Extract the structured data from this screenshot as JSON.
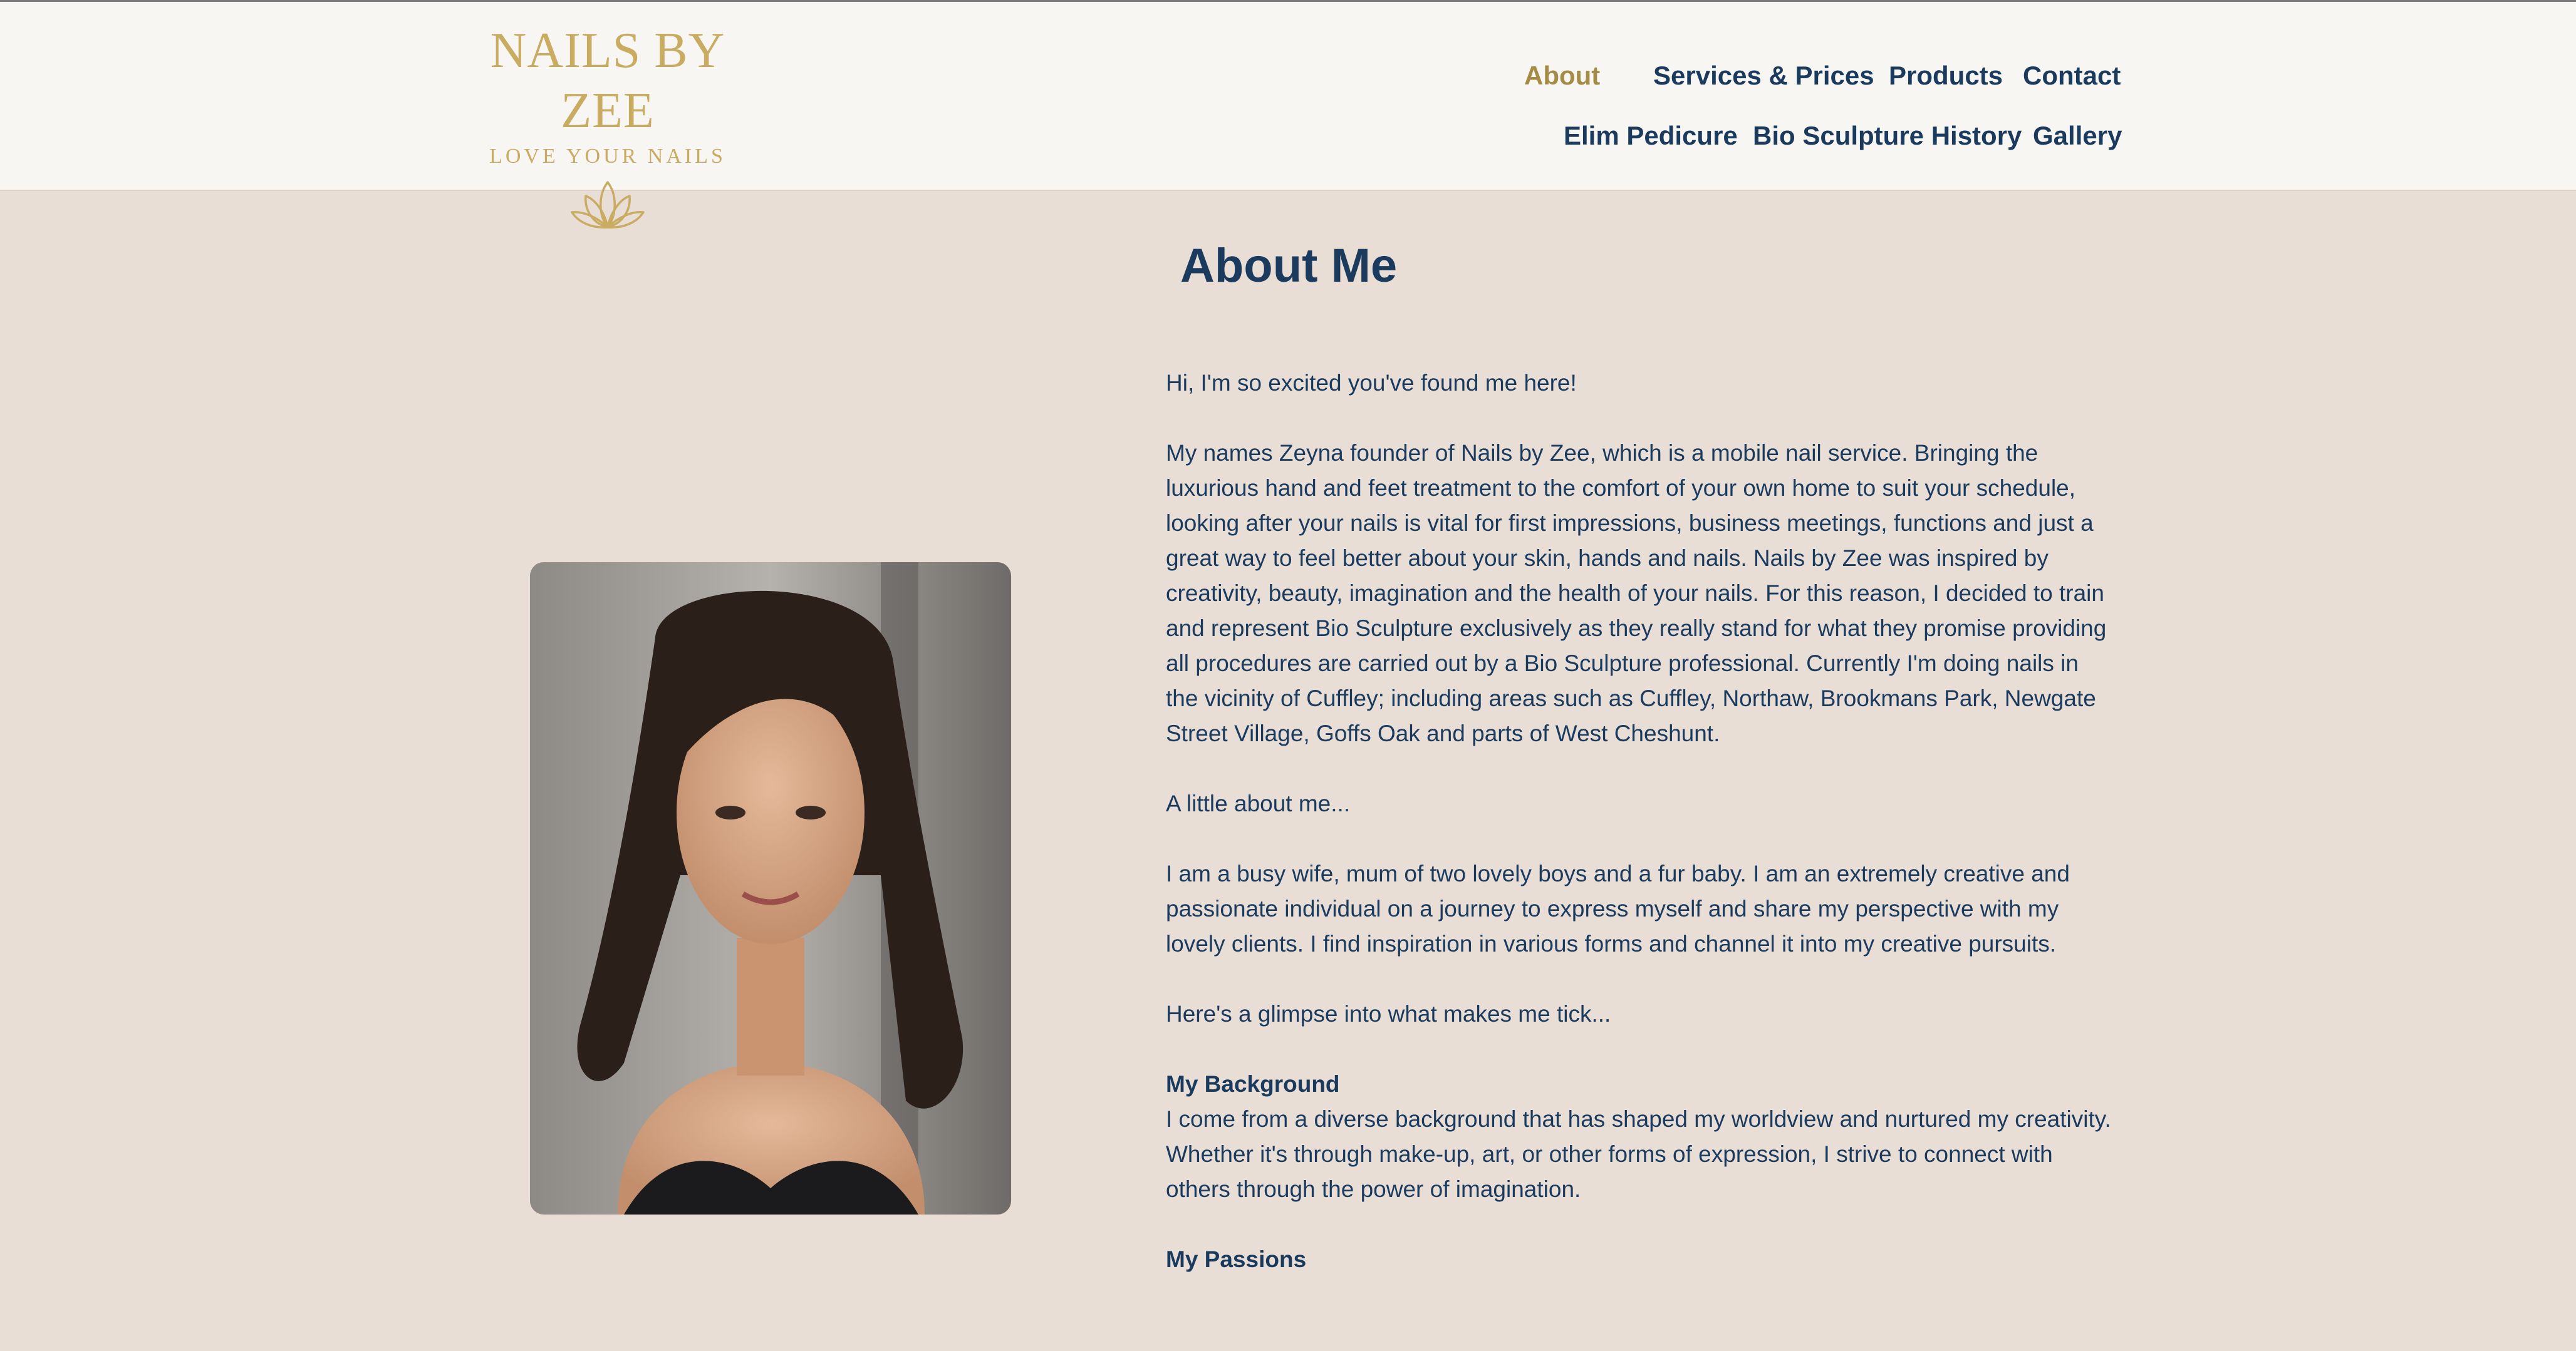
{
  "brand": {
    "name": "NAILS BY ZEE",
    "tagline": "LOVE YOUR NAILS",
    "logo_icon": "lotus-icon",
    "color": "#c9ab62"
  },
  "nav": {
    "items": [
      {
        "label": "About",
        "active": true
      },
      {
        "label": "Services & Prices"
      },
      {
        "label": "Products"
      },
      {
        "label": "Contact"
      },
      {
        "label": "Elim Pedicure"
      },
      {
        "label": "Bio Sculpture History"
      },
      {
        "label": "Gallery"
      }
    ]
  },
  "colors": {
    "page_bg": "#e8ded6",
    "header_bg": "#f8f6f2",
    "text": "#1a3a5e",
    "nav_active": "#a58c45",
    "accent_gold": "#c9ab62"
  },
  "main": {
    "title": "About Me",
    "paragraphs": [
      "Hi, I'm so excited you've found me here!",
      "My names Zeyna founder of Nails by Zee, which is a mobile nail service. Bringing the luxurious hand and feet treatment to the comfort of your own home to suit your schedule, looking after your nails is vital for first impressions, business meetings, functions and just a great way to feel better about your skin, hands and nails. Nails by Zee was inspired by creativity, beauty, imagination and the health of your nails. For this reason, I decided to train and represent Bio Sculpture exclusively as they really stand for what they promise providing all procedures are carried out by a Bio Sculpture professional. Currently I'm doing nails in the vicinity of Cuffley; including areas such as Cuffley, Northaw, Brookmans Park, Newgate Street Village, Goffs Oak and parts of West Cheshunt.",
      "A little about me...",
      "I am a busy wife, mum of two lovely boys and a fur baby. I am an extremely creative and passionate individual on a journey to express myself and share my perspective with my lovely clients. I find inspiration in various forms and channel it into my creative pursuits.",
      "Here's a glimpse into what makes me tick..."
    ],
    "sections": [
      {
        "heading": "My Background",
        "body": "I come from a diverse background that has shaped my worldview and nurtured my creativity. Whether it's through make-up, art, or other forms of expression, I strive to connect with others through the power of imagination."
      },
      {
        "heading": "My Passions",
        "body": ""
      }
    ]
  }
}
